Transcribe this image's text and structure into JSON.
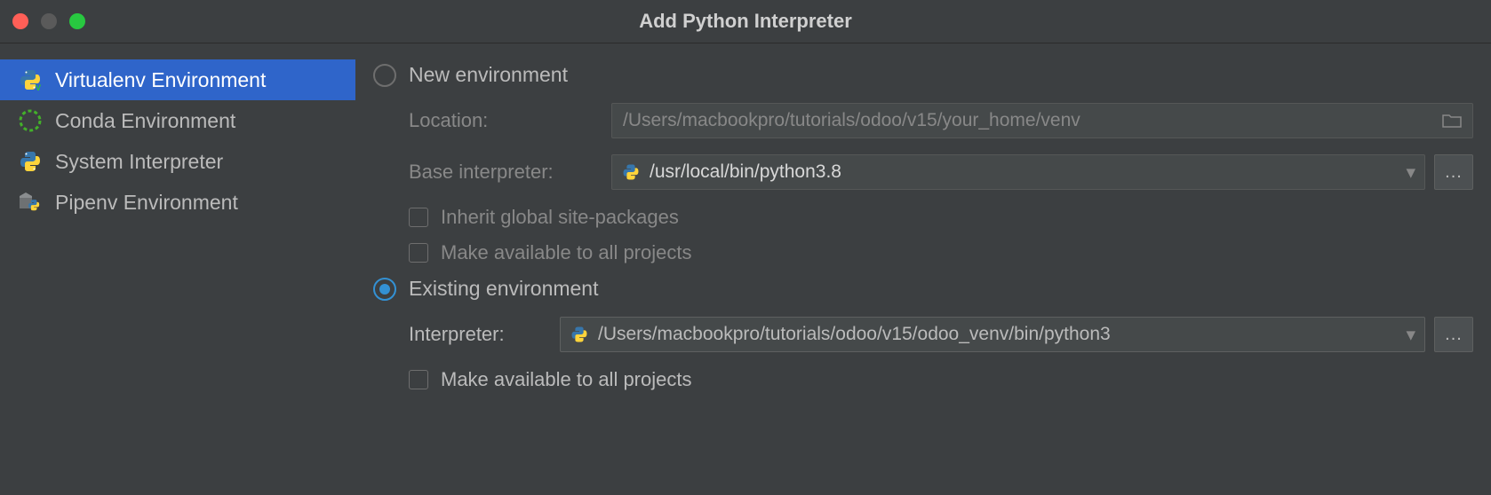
{
  "window": {
    "title": "Add Python Interpreter"
  },
  "sidebar": {
    "items": [
      {
        "label": "Virtualenv Environment",
        "icon": "python-venv-icon",
        "selected": true
      },
      {
        "label": "Conda Environment",
        "icon": "conda-icon",
        "selected": false
      },
      {
        "label": "System Interpreter",
        "icon": "python-icon",
        "selected": false
      },
      {
        "label": "Pipenv Environment",
        "icon": "pipenv-icon",
        "selected": false
      }
    ]
  },
  "form": {
    "new_env": {
      "radio_label": "New environment",
      "selected": false,
      "location_label": "Location:",
      "location_value": "/Users/macbookpro/tutorials/odoo/v15/your_home/venv",
      "base_interpreter_label": "Base interpreter:",
      "base_interpreter_value": "/usr/local/bin/python3.8",
      "inherit_label": "Inherit global site-packages",
      "inherit_checked": false,
      "make_available_label": "Make available to all projects",
      "make_available_checked": false,
      "ellipsis": "..."
    },
    "existing_env": {
      "radio_label": "Existing environment",
      "selected": true,
      "interpreter_label": "Interpreter:",
      "interpreter_value": "/Users/macbookpro/tutorials/odoo/v15/odoo_venv/bin/python3",
      "make_available_label": "Make available to all projects",
      "make_available_checked": false,
      "ellipsis": "..."
    }
  },
  "icons": {
    "dropdown_arrow": "▾",
    "folder": "folder-icon"
  }
}
